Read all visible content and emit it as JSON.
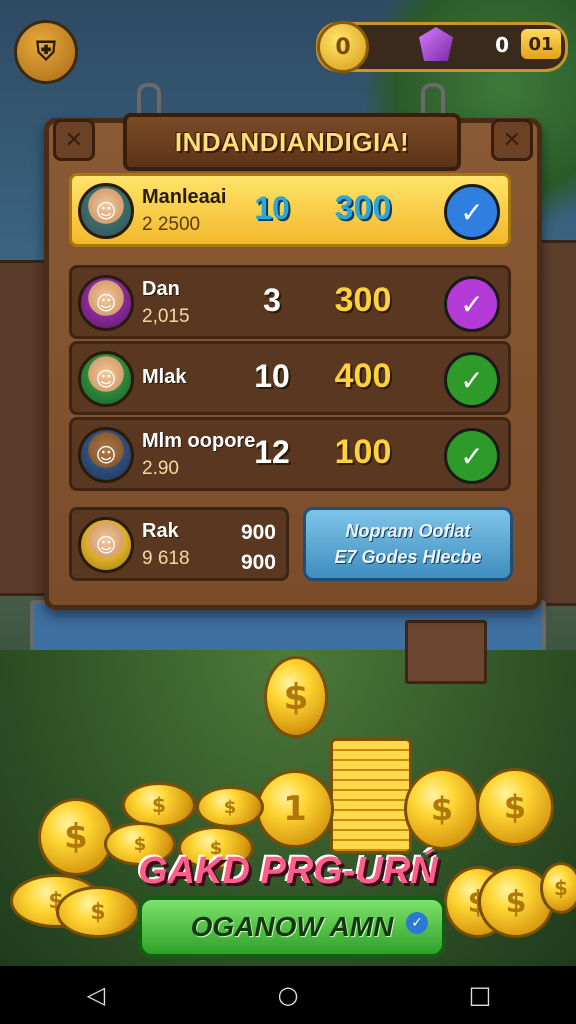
{
  "top_bar": {
    "menu_icon": "shield-menu-icon",
    "coin_symbol": "0",
    "currency_value": "0",
    "currency_box": "01"
  },
  "board": {
    "title": "INDANDIANDIGIA!",
    "corner_icon": "x-icon",
    "rows": [
      {
        "name": "Manleaai",
        "sub": "2 2500",
        "level": "10",
        "score": "300",
        "check_color": "#2f7fe0",
        "highlight": true
      },
      {
        "name": "Dan",
        "sub": "2,015",
        "level": "3",
        "score": "300",
        "check_color": "#b43ad8",
        "highlight": false
      },
      {
        "name": "Mlak",
        "sub": "",
        "level": "10",
        "score": "400",
        "check_color": "#2e9a2a",
        "highlight": false
      },
      {
        "name": "Mlm oopore",
        "sub": "2.90",
        "level": "12",
        "score": "100",
        "check_color": "#2e9a2a",
        "highlight": false
      }
    ],
    "last_row": {
      "name": "Rak",
      "sub": "9 618",
      "val1": "900",
      "val2": "900"
    },
    "info_button": {
      "line1": "Nopram Ooflat",
      "line2": "E7 Godes Hlecbe"
    }
  },
  "promo": {
    "title": "GAKD PRG-URŃ",
    "cta_label": "OGANOW AMN"
  },
  "navbar": {
    "back": "◁",
    "home": "○",
    "recent": "□"
  },
  "colors": {
    "accent_gold": "#ffd23a",
    "cta_green": "#2fa02a",
    "board_wood": "#7a4c2a"
  }
}
